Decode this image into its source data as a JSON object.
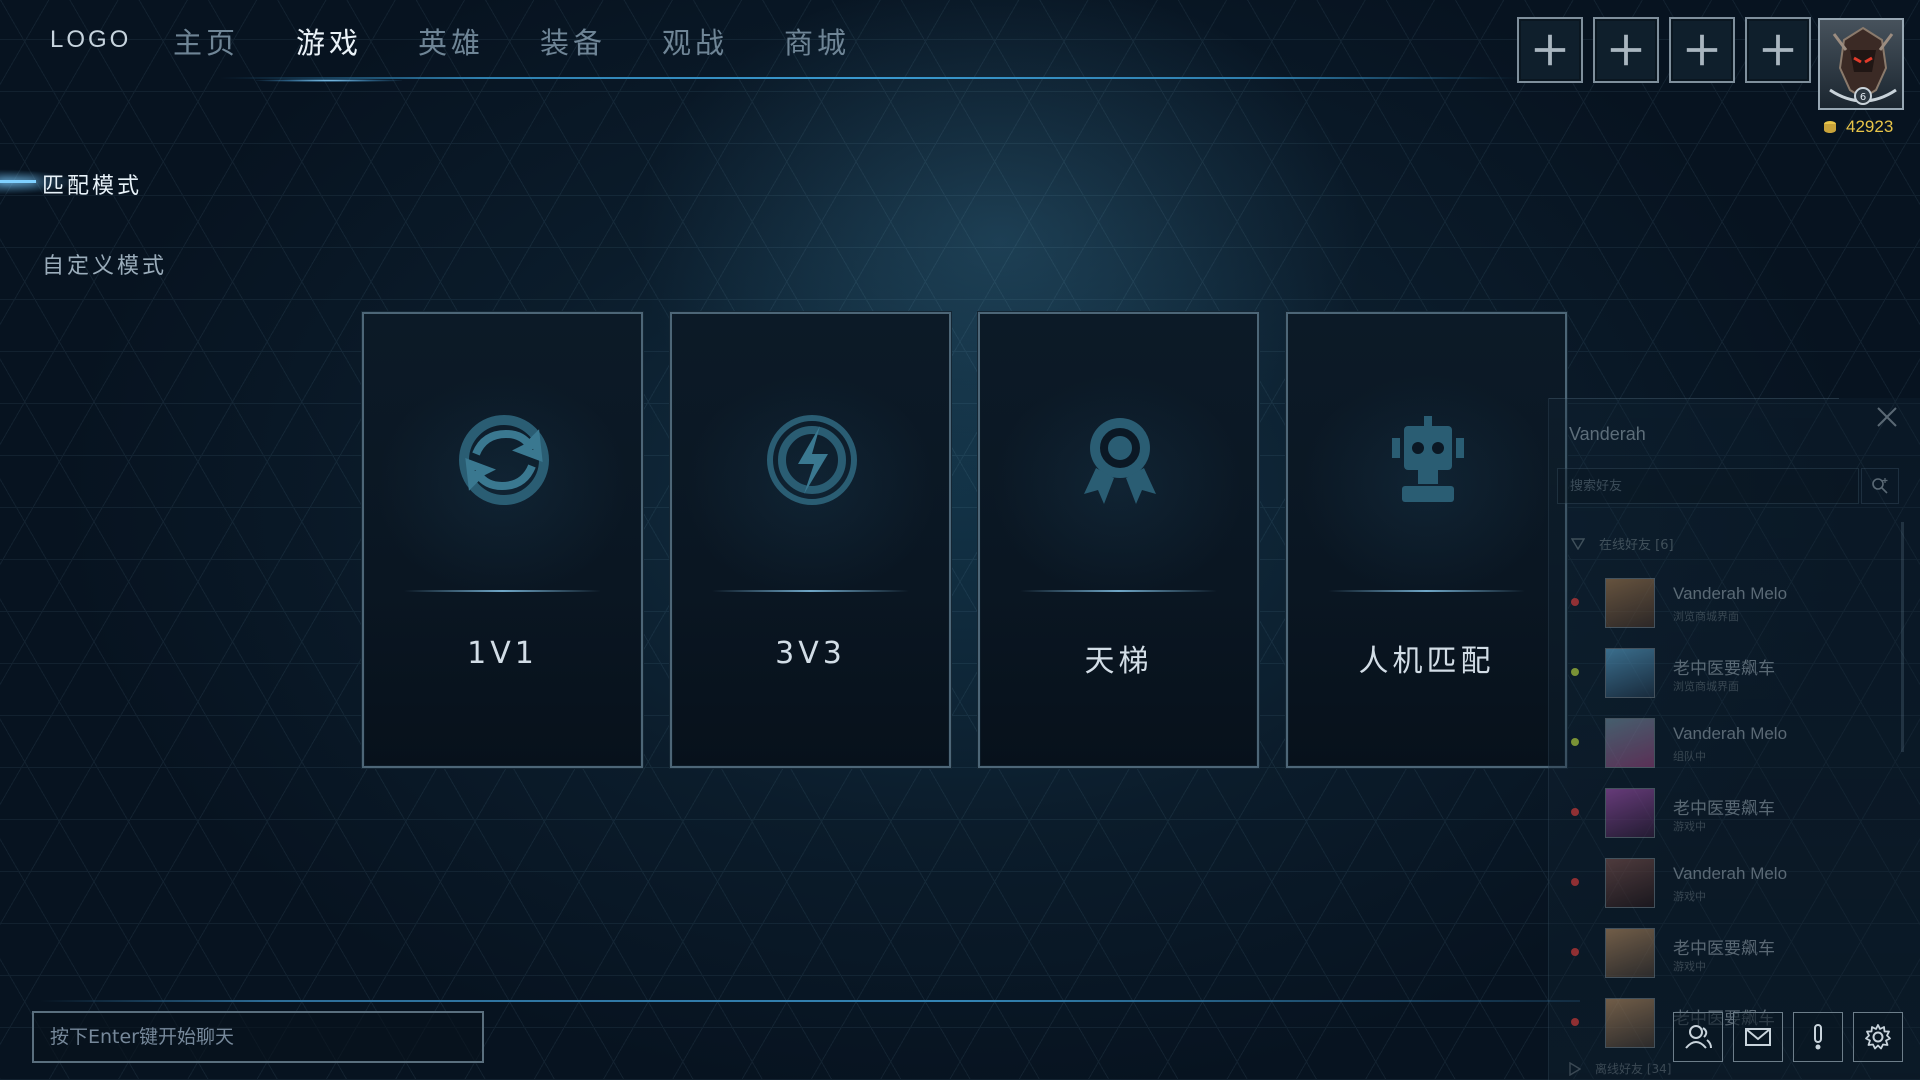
{
  "nav": {
    "logo": "LOGO",
    "items": [
      {
        "label": "主页",
        "active": false
      },
      {
        "label": "游戏",
        "active": true
      },
      {
        "label": "英雄",
        "active": false
      },
      {
        "label": "装备",
        "active": false
      },
      {
        "label": "观战",
        "active": false
      },
      {
        "label": "商城",
        "active": false
      }
    ]
  },
  "top_right": {
    "slots": [
      "plus-icon",
      "plus-icon",
      "plus-icon",
      "plus-icon"
    ],
    "rank_level": "6",
    "coins": "42923",
    "coin_color": "#e8c549"
  },
  "subnav": {
    "items": [
      {
        "label": "匹配模式",
        "active": true
      },
      {
        "label": "自定义模式",
        "active": false
      }
    ]
  },
  "modes": [
    {
      "label": "1V1",
      "icon": "sync-arrows-icon"
    },
    {
      "label": "3V3",
      "icon": "lightning-circle-icon"
    },
    {
      "label": "天梯",
      "icon": "award-ribbon-icon"
    },
    {
      "label": "人机匹配",
      "icon": "robot-icon"
    }
  ],
  "friends": {
    "username": "Vanderah",
    "search_placeholder": "搜索好友",
    "online_header": "在线好友 [6]",
    "list": [
      {
        "name": "Vanderah Melo",
        "status": "浏览商城界面",
        "dot": "#c43a3a"
      },
      {
        "name": "老中医要飙车",
        "status": "浏览商城界面",
        "dot": "#a6c23c"
      },
      {
        "name": "Vanderah Melo",
        "status": "组队中",
        "dot": "#a6c23c"
      },
      {
        "name": "老中医要飙车",
        "status": "游戏中",
        "dot": "#c43a3a"
      },
      {
        "name": "Vanderah Melo",
        "status": "游戏中",
        "dot": "#c43a3a"
      },
      {
        "name": "老中医要飙车",
        "status": "游戏中",
        "dot": "#c43a3a"
      },
      {
        "name": "老中医要飙车",
        "status": "",
        "dot": "#c43a3a"
      }
    ],
    "offline_header": "离线好友 [34]"
  },
  "chat": {
    "placeholder": "按下Enter键开始聊天"
  },
  "tools": [
    "friends-icon",
    "mail-icon",
    "alert-icon",
    "gear-icon"
  ]
}
